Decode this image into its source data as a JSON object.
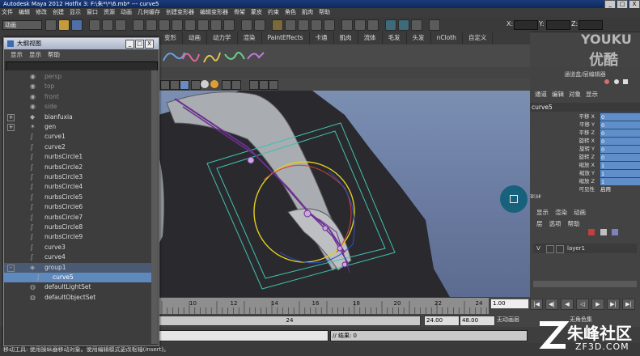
{
  "window": {
    "title": "Autodesk Maya 2012 Hotfix 3: F:\\朱*\\*\\6.mb* --- curve5",
    "controls": [
      "_",
      "□",
      "X"
    ]
  },
  "menubar": [
    "文件",
    "编辑",
    "修改",
    "创建",
    "显示",
    "窗口",
    "资源",
    "动画",
    "几何缓存",
    "创建变形器",
    "编辑变形器",
    "骨架",
    "蒙皮",
    "约束",
    "角色",
    "肌肉",
    "帮助"
  ],
  "statusline": {
    "mode": "动画",
    "xyz": [
      "X:",
      "Y:",
      "Z:"
    ]
  },
  "shelf_tabs": [
    "变形",
    "动画",
    "动力学",
    "渲染",
    "PaintEffects",
    "卡通",
    "肌肉",
    "流体",
    "毛发",
    "头发",
    "nCloth",
    "自定义"
  ],
  "watermark": {
    "brand_en": "YOUKU",
    "brand_cn": "优酷",
    "bottom_cn": "朱峰社区",
    "bottom_en": "ZF3D.COM"
  },
  "outliner": {
    "title": "大纲视图",
    "menu": [
      "显示",
      "显示",
      "帮助"
    ],
    "items": [
      {
        "label": "persp",
        "icon": "camera-icon",
        "expand": "",
        "dim": true
      },
      {
        "label": "top",
        "icon": "camera-icon",
        "expand": "",
        "dim": true
      },
      {
        "label": "front",
        "icon": "camera-icon",
        "expand": "",
        "dim": true
      },
      {
        "label": "side",
        "icon": "camera-icon",
        "expand": "",
        "dim": true
      },
      {
        "label": "bianfuxia",
        "icon": "mesh-icon",
        "expand": "+",
        "dim": false
      },
      {
        "label": "gen",
        "icon": "joint-icon",
        "expand": "+",
        "dim": false
      },
      {
        "label": "curve1",
        "icon": "curve-icon",
        "expand": "",
        "dim": false
      },
      {
        "label": "curve2",
        "icon": "curve-icon",
        "expand": "",
        "dim": false
      },
      {
        "label": "nurbsCircle1",
        "icon": "curve-icon",
        "expand": "",
        "dim": false
      },
      {
        "label": "nurbsCircle2",
        "icon": "curve-icon",
        "expand": "",
        "dim": false
      },
      {
        "label": "nurbsCircle3",
        "icon": "curve-icon",
        "expand": "",
        "dim": false
      },
      {
        "label": "nurbsCircle4",
        "icon": "curve-icon",
        "expand": "",
        "dim": false
      },
      {
        "label": "nurbsCircle5",
        "icon": "curve-icon",
        "expand": "",
        "dim": false
      },
      {
        "label": "nurbsCircle6",
        "icon": "curve-icon",
        "expand": "",
        "dim": false
      },
      {
        "label": "nurbsCircle7",
        "icon": "curve-icon",
        "expand": "",
        "dim": false
      },
      {
        "label": "nurbsCircle8",
        "icon": "curve-icon",
        "expand": "",
        "dim": false
      },
      {
        "label": "nurbsCircle9",
        "icon": "curve-icon",
        "expand": "",
        "dim": false
      },
      {
        "label": "curve3",
        "icon": "curve-icon",
        "expand": "",
        "dim": false
      },
      {
        "label": "curve4",
        "icon": "curve-icon",
        "expand": "",
        "dim": false
      },
      {
        "label": "group1",
        "icon": "group-icon",
        "expand": "-",
        "dim": false,
        "highlight": true
      },
      {
        "label": "curve5",
        "icon": "curve-icon",
        "expand": "",
        "dim": false,
        "selected": true,
        "indent": true
      },
      {
        "label": "defaultLightSet",
        "icon": "set-icon",
        "expand": "",
        "dim": false
      },
      {
        "label": "defaultObjectSet",
        "icon": "set-icon",
        "expand": "",
        "dim": false
      }
    ]
  },
  "channel_box": {
    "header": "通道盒/层编辑器",
    "tabs": [
      "通道",
      "编辑",
      "对象",
      "显示"
    ],
    "node": "curve5",
    "attrs": [
      {
        "label": "平移 X",
        "value": "0"
      },
      {
        "label": "平移 Y",
        "value": "0"
      },
      {
        "label": "平移 Z",
        "value": "0"
      },
      {
        "label": "旋转 X",
        "value": "0"
      },
      {
        "label": "旋转 Y",
        "value": "0"
      },
      {
        "label": "旋转 Z",
        "value": "0"
      },
      {
        "label": "缩放 X",
        "value": "1"
      },
      {
        "label": "缩放 Y",
        "value": "1"
      },
      {
        "label": "缩放 Z",
        "value": "1"
      },
      {
        "label": "可见性",
        "value": "启用"
      }
    ],
    "shape_label": "形状"
  },
  "layer_editor": {
    "tabs": [
      "显示",
      "渲染",
      "动画"
    ],
    "menu": [
      "层",
      "选项",
      "帮助"
    ],
    "layer": {
      "v": "V",
      "name": "layer1"
    }
  },
  "timeline": {
    "ticks": [
      "10",
      "12",
      "14",
      "16",
      "18",
      "20",
      "22",
      "24"
    ],
    "current_time": "1.00",
    "range_current": "24",
    "range_end": "24.00",
    "range_max": "48.00",
    "anim_layer": "无动画层",
    "char_set": "无角色集"
  },
  "command_line": {
    "result": "// 结果: 0"
  },
  "help_line": "移动工具: 使用操纵器移动对象。使用编辑模式更改枢轴(Insert)。"
}
